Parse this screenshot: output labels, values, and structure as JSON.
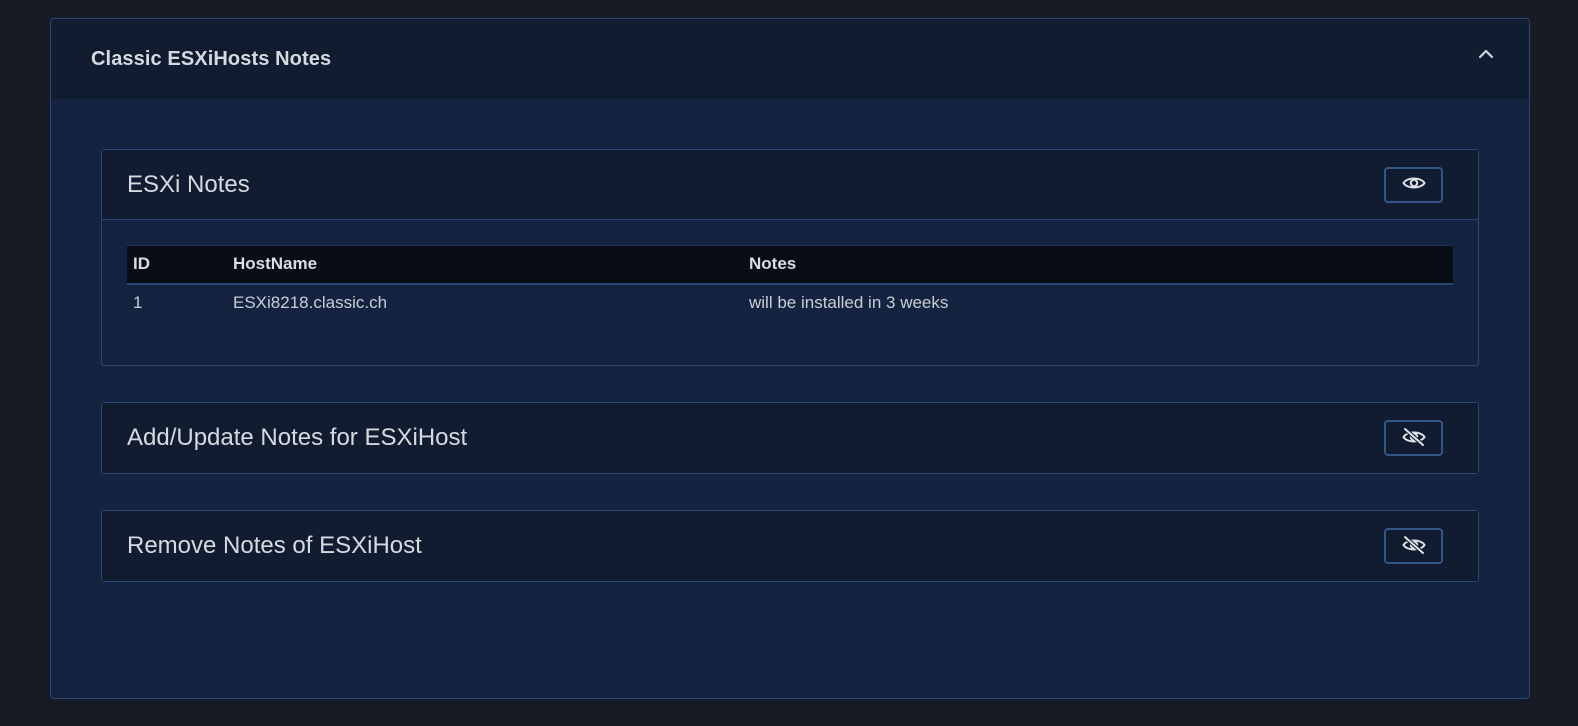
{
  "panel": {
    "title": "Classic ESXiHosts Notes",
    "collapse_icon": "chevron-up-icon"
  },
  "cards": [
    {
      "title": "ESXi Notes",
      "visibility_icon": "eye-icon",
      "expanded": true,
      "table": {
        "headers": [
          "ID",
          "HostName",
          "Notes"
        ],
        "rows": [
          [
            "1",
            "ESXi8218.classic.ch",
            "will be installed in 3 weeks"
          ]
        ]
      }
    },
    {
      "title": "Add/Update Notes for ESXiHost",
      "visibility_icon": "eye-slash-icon",
      "expanded": false
    },
    {
      "title": "Remove Notes of ESXiHost",
      "visibility_icon": "eye-slash-icon",
      "expanded": false
    }
  ],
  "colors": {
    "page_bg": "#161b25",
    "panel_bg": "#142340",
    "header_bg": "#111c30",
    "border": "#2a4775",
    "table_header_bg": "#080c14",
    "text": "#d4d8de"
  }
}
